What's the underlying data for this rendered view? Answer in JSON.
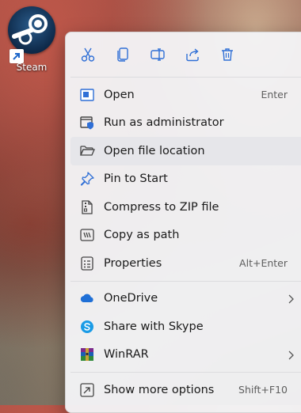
{
  "desktop": {
    "icon_label": "Steam"
  },
  "toolbar": {
    "icons": [
      "cut-icon",
      "copy-icon",
      "rename-icon",
      "share-icon",
      "delete-icon"
    ]
  },
  "menu": {
    "open": {
      "label": "Open",
      "accel": "Enter"
    },
    "run_admin": {
      "label": "Run as administrator"
    },
    "open_location": {
      "label": "Open file location"
    },
    "pin_start": {
      "label": "Pin to Start"
    },
    "compress_zip": {
      "label": "Compress to ZIP file"
    },
    "copy_path": {
      "label": "Copy as path"
    },
    "properties": {
      "label": "Properties",
      "accel": "Alt+Enter"
    },
    "onedrive": {
      "label": "OneDrive"
    },
    "skype": {
      "label": "Share with Skype"
    },
    "winrar": {
      "label": "WinRAR"
    },
    "more_options": {
      "label": "Show more options",
      "accel": "Shift+F10"
    }
  },
  "colors": {
    "icon_blue": "#2f6fd6",
    "menu_bg": "#f4f4f6",
    "hover_bg": "#e6e6ea"
  }
}
